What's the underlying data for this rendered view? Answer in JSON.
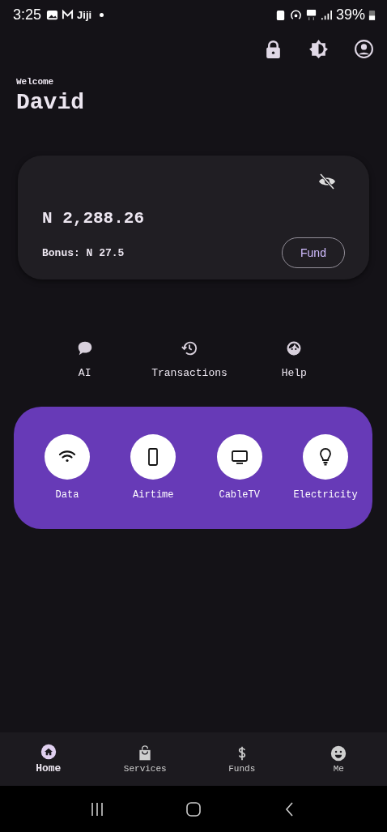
{
  "status_bar": {
    "time": "3:25",
    "app_label": "Jiji",
    "battery": "39%"
  },
  "welcome": "Welcome",
  "user_name": "David",
  "balance_card": {
    "balance": "N 2,288.26",
    "bonus": "Bonus: N 27.5",
    "fund_button": "Fund"
  },
  "quick_actions": [
    {
      "kind": "chat",
      "label": "AI"
    },
    {
      "kind": "history",
      "label": "Transactions"
    },
    {
      "kind": "support",
      "label": "Help"
    }
  ],
  "services": [
    {
      "kind": "wifi",
      "label": "Data"
    },
    {
      "kind": "phone",
      "label": "Airtime"
    },
    {
      "kind": "tv",
      "label": "CableTV"
    },
    {
      "kind": "bulb",
      "label": "Electricity"
    }
  ],
  "bottom_nav": [
    {
      "kind": "home",
      "label": "Home",
      "selected": true
    },
    {
      "kind": "bag",
      "label": "Services",
      "selected": false
    },
    {
      "kind": "dollar",
      "label": "Funds",
      "selected": false
    },
    {
      "kind": "smile",
      "label": "Me",
      "selected": false
    }
  ]
}
